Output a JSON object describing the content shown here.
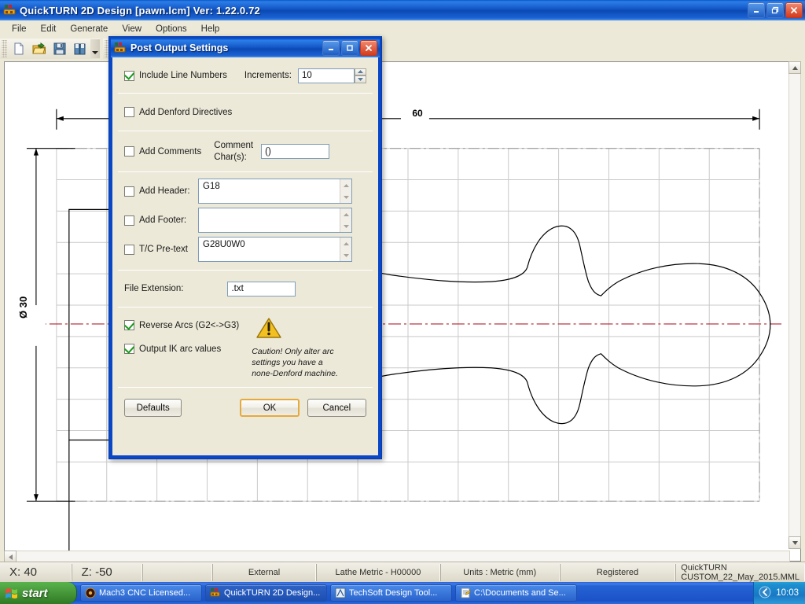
{
  "window": {
    "title": "QuickTURN 2D Design [pawn.lcm] Ver: 1.22.0.72",
    "icon": "app-icon",
    "minimize_label": "_",
    "maximize_label": "❐",
    "close_label": "✕"
  },
  "menu": {
    "items": [
      {
        "label": "File"
      },
      {
        "label": "Edit"
      },
      {
        "label": "Generate"
      },
      {
        "label": "View"
      },
      {
        "label": "Options"
      },
      {
        "label": "Help"
      }
    ]
  },
  "toolbar": {
    "groups": [
      {
        "buttons": [
          {
            "icon": "new-document-icon",
            "selected": false
          },
          {
            "icon": "open-folder-icon",
            "selected": false
          },
          {
            "icon": "save-disk-icon",
            "selected": false
          },
          {
            "icon": "save-as-disk-icon",
            "selected": false
          }
        ]
      },
      {
        "buttons": [
          {
            "icon": "lathe-stock-icon",
            "selected": false
          },
          {
            "icon": "grid-toggle-icon",
            "selected": true
          },
          {
            "icon": "snap-axes-icon",
            "selected": true
          },
          {
            "icon": "dimension-icon",
            "selected": false
          }
        ]
      },
      {
        "buttons": [
          {
            "icon": "zoom-window-icon",
            "selected": false
          },
          {
            "icon": "zoom-extents-icon",
            "selected": false
          },
          {
            "icon": "zoom-in-icon",
            "selected": false
          },
          {
            "icon": "zoom-out-icon",
            "selected": false
          }
        ]
      },
      {
        "buttons": [
          {
            "icon": "post-output-icon",
            "selected": false
          }
        ]
      }
    ]
  },
  "drawing": {
    "horizontal_dimension": "60",
    "vertical_dimension": "Ø 30",
    "centreline_color": "#b02030",
    "grid_color": "#c9c9c9",
    "profile_color": "#000000"
  },
  "scrollbars": {
    "vertical": {
      "up": "▲",
      "down": "▼"
    },
    "horizontal": {
      "left": "◄",
      "right": "►"
    }
  },
  "status_bar": {
    "x_value": "X: 40",
    "z_value": "Z: -50",
    "blank": "",
    "mode": "External",
    "machine": "Lathe Metric - H00000",
    "units": "Units : Metric (mm)",
    "licence": "Registered",
    "post": "QuickTURN CUSTOM_22_May_2015.MML"
  },
  "dialog": {
    "title": "Post Output Settings",
    "icon": "post-output-icon",
    "minimize_label": "_",
    "maximize_label": "❐",
    "close_label": "✕",
    "include_line_numbers": {
      "label": "Include Line Numbers",
      "checked": true
    },
    "increments": {
      "label": "Increments:",
      "value": "10"
    },
    "add_denford_directives": {
      "label": "Add Denford Directives",
      "checked": false
    },
    "add_comments": {
      "label": "Add Comments",
      "checked": false
    },
    "comment_chars": {
      "label_line1": "Comment",
      "label_line2": "Char(s):",
      "value": "()"
    },
    "add_header": {
      "label": "Add Header:",
      "checked": false,
      "value": "G18"
    },
    "add_footer": {
      "label": "Add Footer:",
      "checked": false,
      "value": ""
    },
    "tc_pretext": {
      "label": "T/C Pre-text",
      "checked": false,
      "value": "G28U0W0"
    },
    "file_extension": {
      "label": "File Extension:",
      "value": ".txt"
    },
    "reverse_arcs": {
      "label": "Reverse Arcs (G2<->G3)",
      "checked": true
    },
    "output_ik": {
      "label": "Output IK arc values",
      "checked": true
    },
    "caution": {
      "icon": "warning-triangle-icon",
      "text": "Caution! Only alter arc settings you have a none-Denford machine."
    },
    "buttons": {
      "defaults": "Defaults",
      "ok": "OK",
      "cancel": "Cancel"
    }
  },
  "taskbar": {
    "start_label": "start",
    "start_icon": "windows-flag-icon",
    "tasks": [
      {
        "icon": "mach3-icon",
        "label": "Mach3 CNC  Licensed...",
        "active": false
      },
      {
        "icon": "quickturn-icon",
        "label": "QuickTURN 2D Design...",
        "active": true
      },
      {
        "icon": "techsoft-icon",
        "label": "TechSoft Design Tool...",
        "active": false
      },
      {
        "icon": "folder-icon",
        "label": "C:\\Documents and Se...",
        "active": false
      }
    ],
    "tray": {
      "show_hidden_icon": "chevron-left-icon",
      "clock": "10:03"
    }
  }
}
